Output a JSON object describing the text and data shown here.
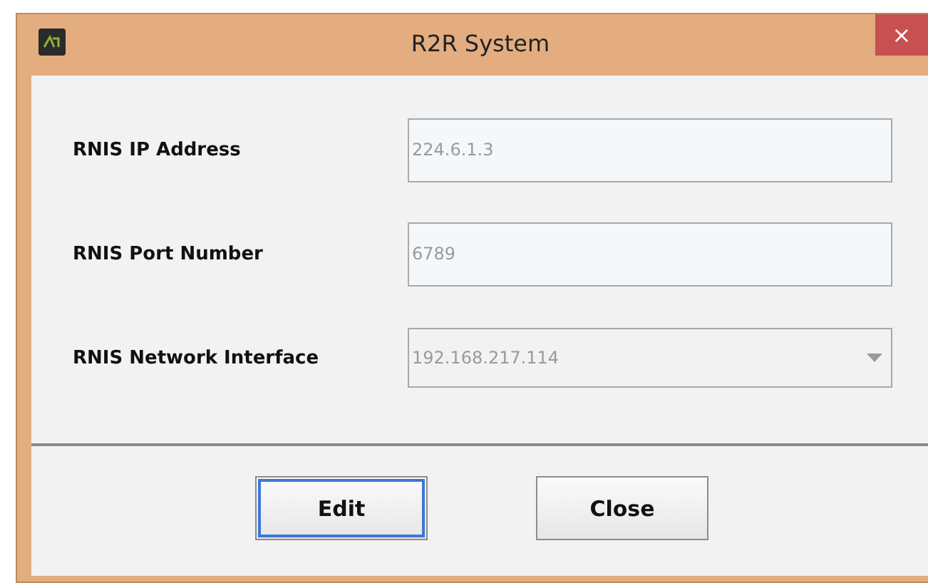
{
  "window": {
    "title": "R2R System",
    "close": "×"
  },
  "fields": [
    {
      "kind": "text",
      "label": "RNIS IP Address",
      "value": "224.6.1.3",
      "disabled": true
    },
    {
      "kind": "text",
      "label": "RNIS Port Number",
      "value": "6789",
      "disabled": true
    },
    {
      "kind": "combo",
      "label": "RNIS Network Interface",
      "value": "192.168.217.114",
      "disabled": true
    }
  ],
  "buttons": [
    {
      "label": "Edit",
      "focused": true
    },
    {
      "label": "Close",
      "focused": false
    }
  ]
}
